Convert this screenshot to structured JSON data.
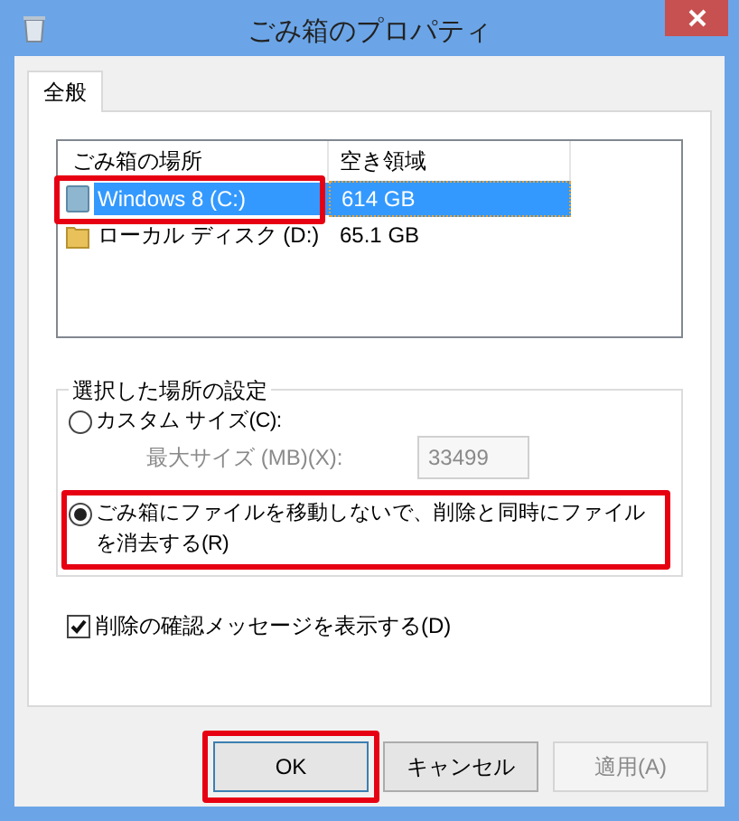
{
  "window": {
    "title": "ごみ箱のプロパティ"
  },
  "tabs": [
    {
      "label": "全般",
      "selected": true
    }
  ],
  "locations": {
    "columns": [
      "ごみ箱の場所",
      "空き領域"
    ],
    "rows": [
      {
        "name": "Windows 8 (C:)",
        "free": "614 GB",
        "kind": "system",
        "selected": true,
        "highlighted": true
      },
      {
        "name": "ローカル ディスク (D:)",
        "free": "65.1 GB",
        "kind": "folder",
        "selected": false
      }
    ]
  },
  "settings": {
    "title": "選択した場所の設定",
    "options": [
      {
        "label": "カスタム サイズ(C):",
        "selected": false
      },
      {
        "label": "ごみ箱にファイルを移動しないで、削除と同時にファイルを消去する(R)",
        "selected": true,
        "highlighted": true
      }
    ],
    "max_size": {
      "label": "最大サイズ (MB)(X):",
      "value": "33499",
      "disabled": true
    }
  },
  "confirm": {
    "label": "削除の確認メッセージを表示する(D)",
    "checked": true
  },
  "buttons": [
    {
      "label": "OK",
      "default": true,
      "disabled": false,
      "highlighted": true
    },
    {
      "label": "キャンセル",
      "default": false,
      "disabled": false
    },
    {
      "label": "適用(A)",
      "default": false,
      "disabled": true
    }
  ]
}
